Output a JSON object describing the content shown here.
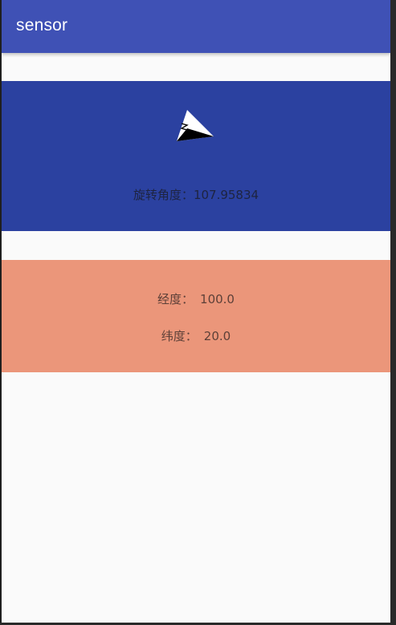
{
  "app_bar": {
    "title": "sensor"
  },
  "compass": {
    "icon": "compass-arrow-icon",
    "label": "旋转角度：",
    "value": "107.95834"
  },
  "location": {
    "longitude_label": "经度：",
    "longitude_value": "100.0",
    "latitude_label": "纬度：",
    "latitude_value": "20.0"
  },
  "colors": {
    "app_bar": "#3f51b5",
    "compass_panel": "#2b41a0",
    "location_panel": "#eb967a",
    "background": "#fafafa"
  }
}
